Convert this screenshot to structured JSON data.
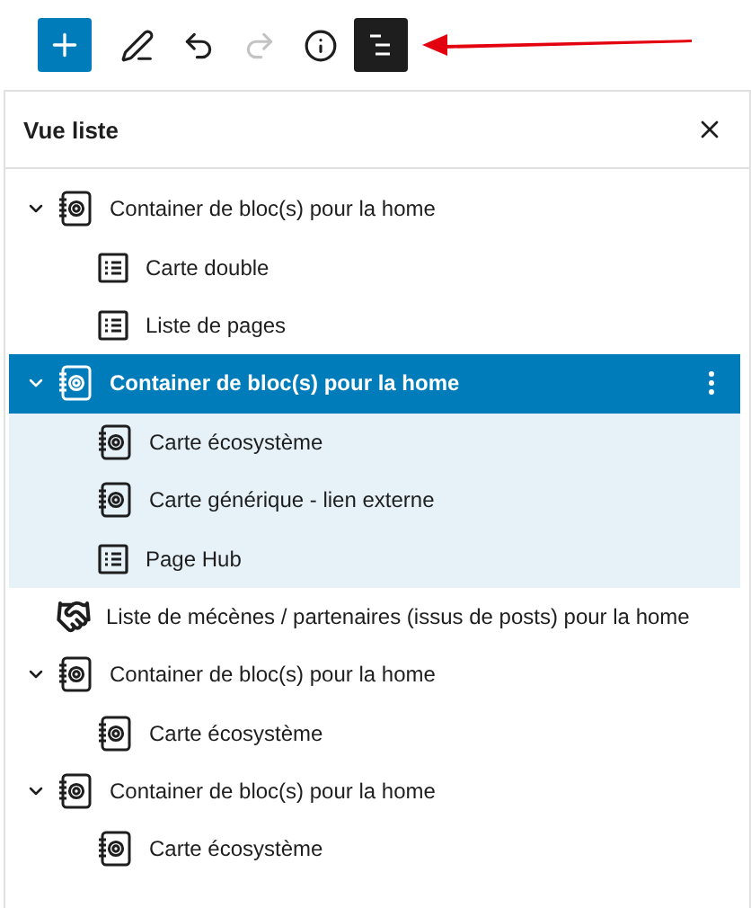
{
  "toolbar": [
    {
      "kind": "add",
      "disabled": false,
      "pressed": false
    },
    {
      "kind": "edit",
      "disabled": false,
      "pressed": false
    },
    {
      "kind": "undo",
      "disabled": false,
      "pressed": false
    },
    {
      "kind": "redo",
      "disabled": true,
      "pressed": false
    },
    {
      "kind": "info",
      "disabled": false,
      "pressed": false
    },
    {
      "kind": "list_view",
      "disabled": false,
      "pressed": true
    }
  ],
  "panel": {
    "title": "Vue liste"
  },
  "tree": [
    {
      "label": "Container de bloc(s) pour la home",
      "kind": "container",
      "expanded": true,
      "selected": false,
      "children": [
        {
          "label": "Carte double",
          "kind": "list",
          "selected": false
        },
        {
          "label": "Liste de pages",
          "kind": "list",
          "selected": false
        }
      ]
    },
    {
      "label": "Container de bloc(s) pour la home",
      "kind": "container",
      "expanded": true,
      "selected": true,
      "children": [
        {
          "label": "Carte écosystème",
          "kind": "container",
          "selected": false
        },
        {
          "label": "Carte générique - lien externe",
          "kind": "container",
          "selected": false
        },
        {
          "label": "Page Hub",
          "kind": "list",
          "selected": false
        }
      ]
    },
    {
      "label": "Liste de mécènes / partenaires (issus de posts) pour la home",
      "kind": "handshake",
      "selected": false
    },
    {
      "label": "Container de bloc(s) pour la home",
      "kind": "container",
      "expanded": true,
      "selected": false,
      "children": [
        {
          "label": "Carte écosystème",
          "kind": "container",
          "selected": false
        }
      ]
    },
    {
      "label": "Container de bloc(s) pour la home",
      "kind": "container",
      "expanded": true,
      "selected": false,
      "children": [
        {
          "label": "Carte écosystème",
          "kind": "container",
          "selected": false
        }
      ]
    }
  ]
}
